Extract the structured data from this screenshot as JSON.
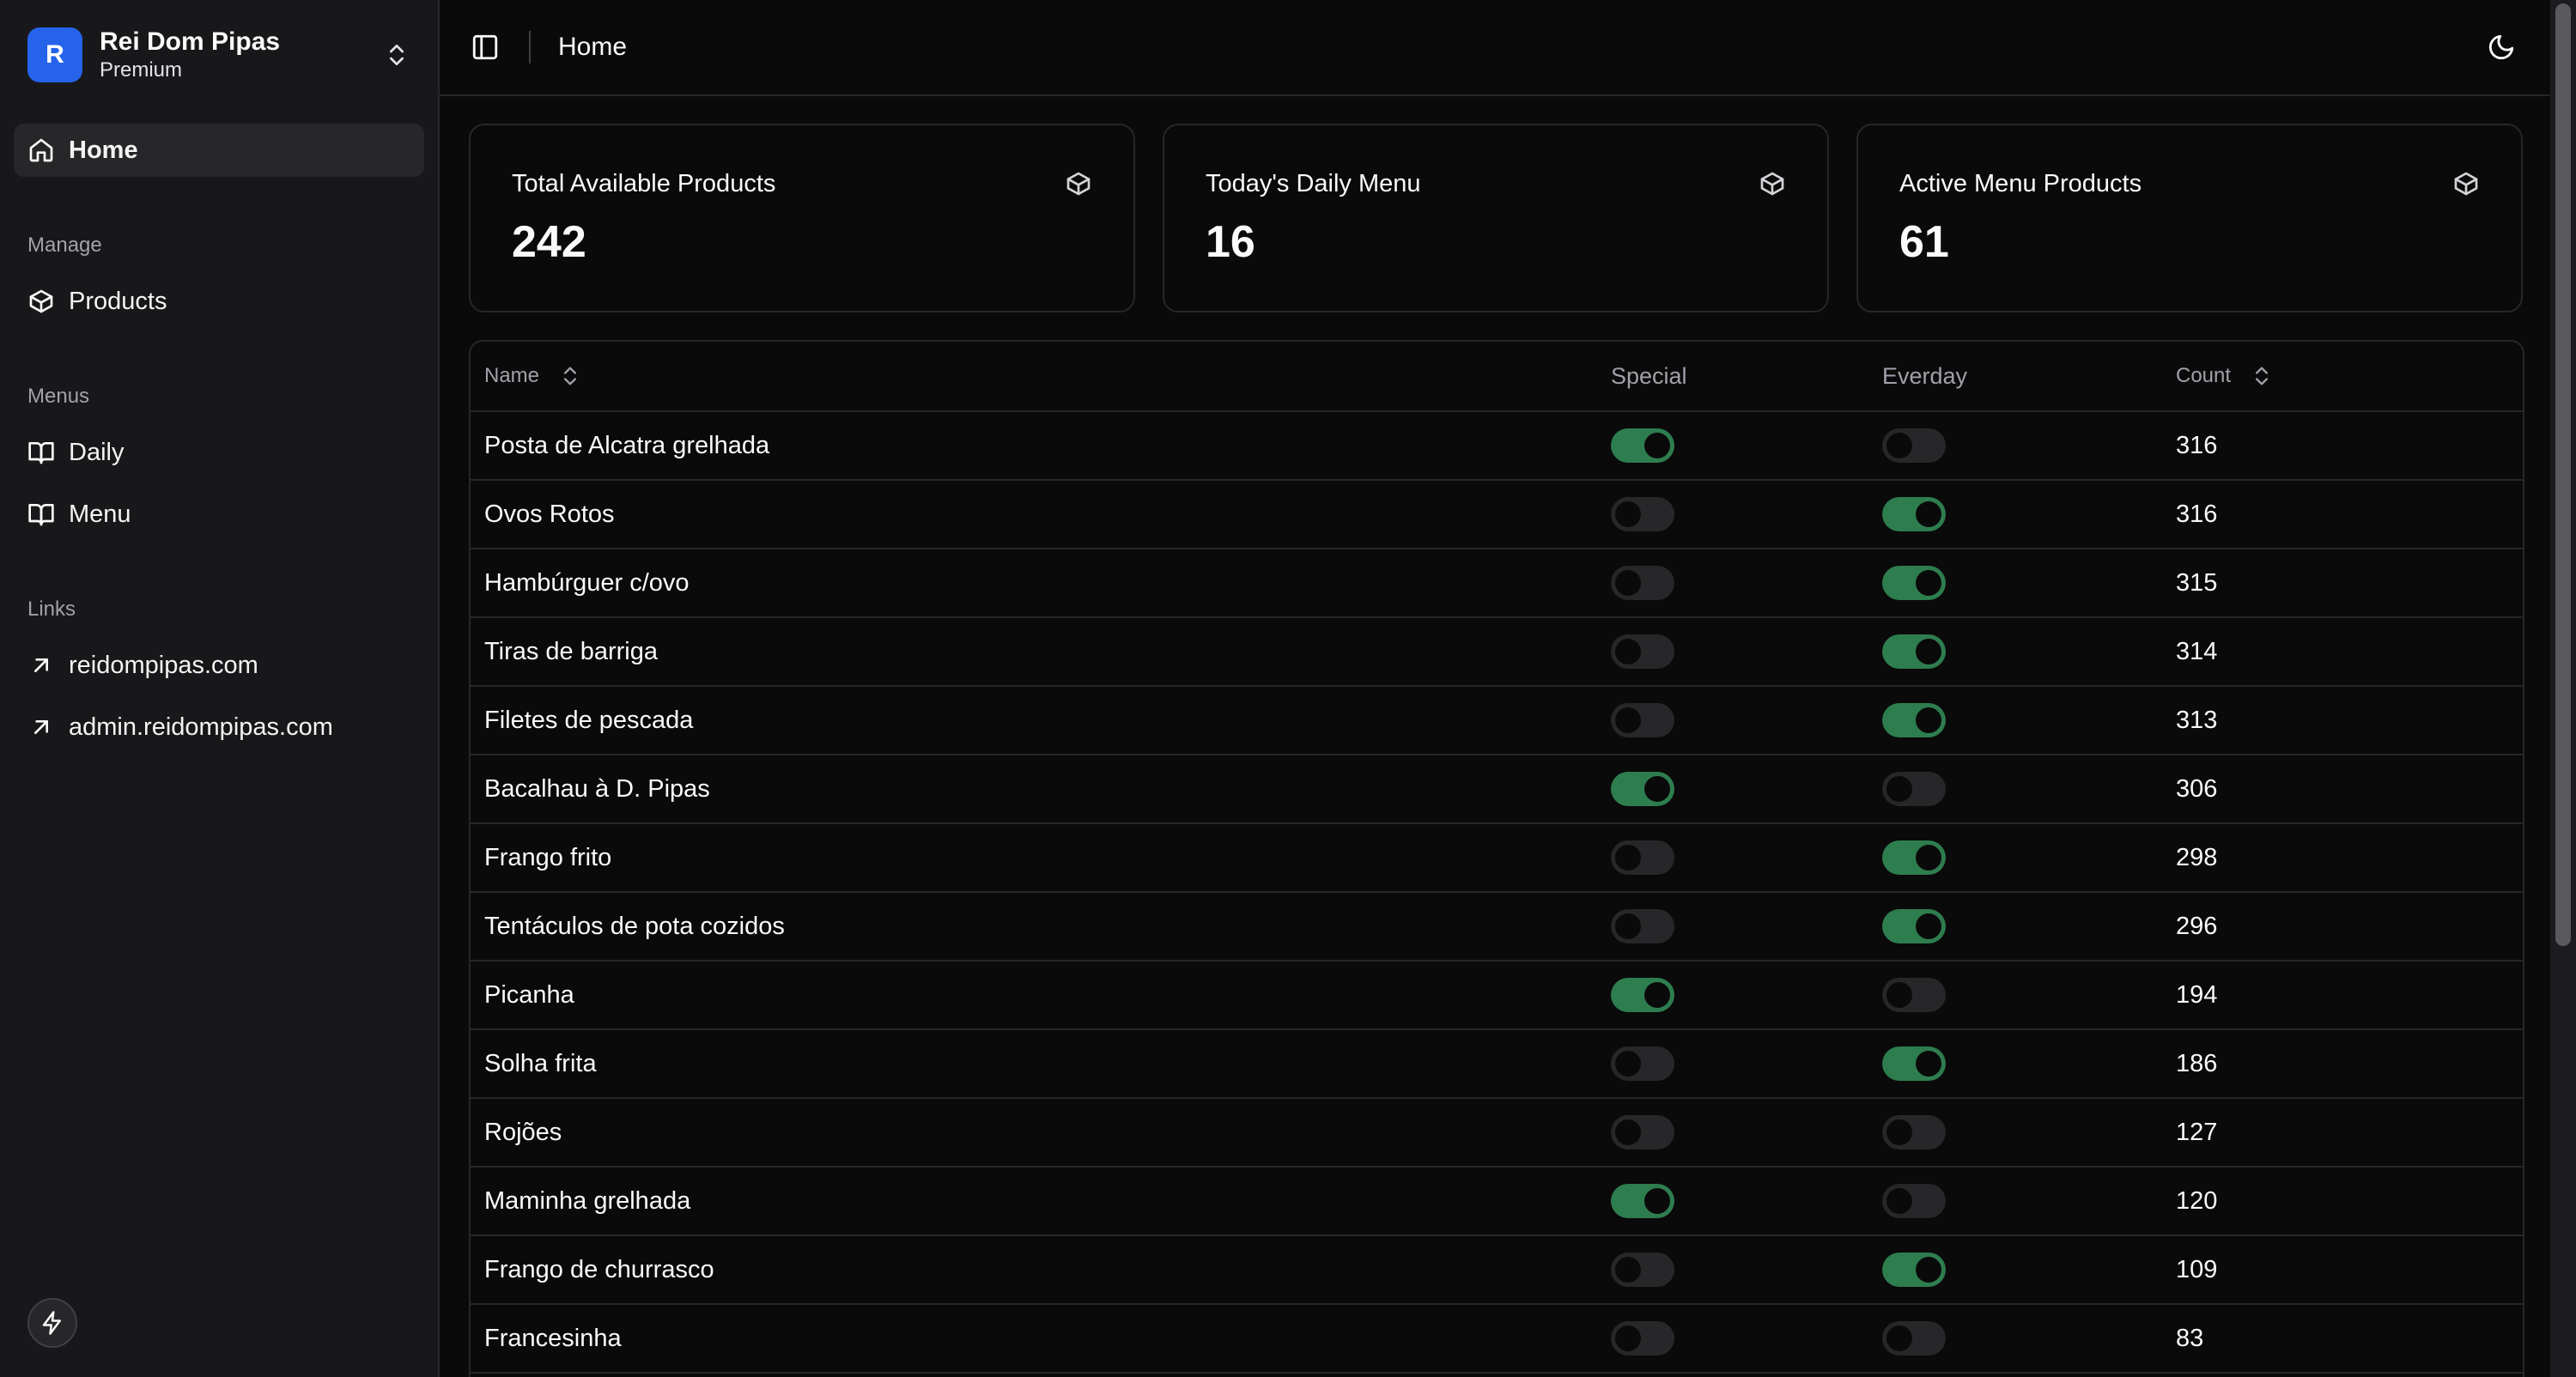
{
  "brand": {
    "initial": "R",
    "name": "Rei Dom Pipas",
    "plan": "Premium"
  },
  "sidebar": {
    "home": "Home",
    "groups": [
      {
        "label": "Manage",
        "items": [
          "Products"
        ]
      },
      {
        "label": "Menus",
        "items": [
          "Daily",
          "Menu"
        ]
      },
      {
        "label": "Links",
        "items": [
          "reidompipas.com",
          "admin.reidompipas.com"
        ]
      }
    ]
  },
  "topbar": {
    "breadcrumb": "Home"
  },
  "stats": [
    {
      "title": "Total Available Products",
      "value": "242"
    },
    {
      "title": "Today's Daily Menu",
      "value": "16"
    },
    {
      "title": "Active Menu Products",
      "value": "61"
    }
  ],
  "table": {
    "columns": {
      "name": "Name",
      "special": "Special",
      "everyday": "Everday",
      "count": "Count"
    },
    "rows": [
      {
        "name": "Posta de Alcatra grelhada",
        "special": true,
        "everyday": false,
        "count": "316"
      },
      {
        "name": "Ovos Rotos",
        "special": false,
        "everyday": true,
        "count": "316"
      },
      {
        "name": "Hambúrguer c/ovo",
        "special": false,
        "everyday": true,
        "count": "315"
      },
      {
        "name": "Tiras de barriga",
        "special": false,
        "everyday": true,
        "count": "314"
      },
      {
        "name": "Filetes de pescada",
        "special": false,
        "everyday": true,
        "count": "313"
      },
      {
        "name": "Bacalhau à D. Pipas",
        "special": true,
        "everyday": false,
        "count": "306"
      },
      {
        "name": "Frango frito",
        "special": false,
        "everyday": true,
        "count": "298"
      },
      {
        "name": "Tentáculos de pota cozidos",
        "special": false,
        "everyday": true,
        "count": "296"
      },
      {
        "name": "Picanha",
        "special": true,
        "everyday": false,
        "count": "194"
      },
      {
        "name": "Solha frita",
        "special": false,
        "everyday": true,
        "count": "186"
      },
      {
        "name": "Rojões",
        "special": false,
        "everyday": false,
        "count": "127"
      },
      {
        "name": "Maminha grelhada",
        "special": true,
        "everyday": false,
        "count": "120"
      },
      {
        "name": "Frango de churrasco",
        "special": false,
        "everyday": true,
        "count": "109"
      },
      {
        "name": "Francesinha",
        "special": false,
        "everyday": false,
        "count": "83"
      }
    ]
  },
  "colors": {
    "accent": "#2563eb",
    "toggle_on": "#2e7d4f",
    "background": "#0a0a0a",
    "sidebar": "#18181b"
  }
}
